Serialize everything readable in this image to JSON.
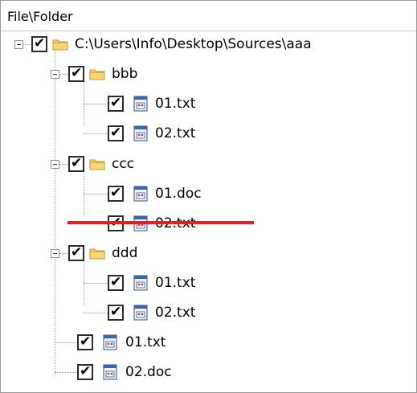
{
  "header": {
    "column_title": "File\\Folder"
  },
  "tree": {
    "root": {
      "label": "C:\\Users\\Info\\Desktop\\Sources\\aaa",
      "checked": true,
      "expanded": true
    },
    "folders": [
      {
        "label": "bbb",
        "checked": true,
        "expanded": true,
        "files": [
          {
            "label": "01.txt",
            "checked": true
          },
          {
            "label": "02.txt",
            "checked": true
          }
        ]
      },
      {
        "label": "ccc",
        "checked": true,
        "expanded": true,
        "files": [
          {
            "label": "01.doc",
            "checked": true
          },
          {
            "label": "02.txt",
            "checked": true,
            "struck_out": true
          }
        ]
      },
      {
        "label": "ddd",
        "checked": true,
        "expanded": true,
        "files": [
          {
            "label": "01.txt",
            "checked": true
          },
          {
            "label": "02.txt",
            "checked": true
          }
        ]
      }
    ],
    "root_files": [
      {
        "label": "01.txt",
        "checked": true
      },
      {
        "label": "02.doc",
        "checked": true
      }
    ]
  },
  "icons": {
    "folder": "folder-icon",
    "file": "file-icon",
    "check": "checkmark-icon",
    "collapse": "collapse-minus-icon"
  },
  "colors": {
    "strike_line": "#e31e24",
    "folder_fill": "#f5d77a"
  },
  "checkmark_glyph": "✔"
}
